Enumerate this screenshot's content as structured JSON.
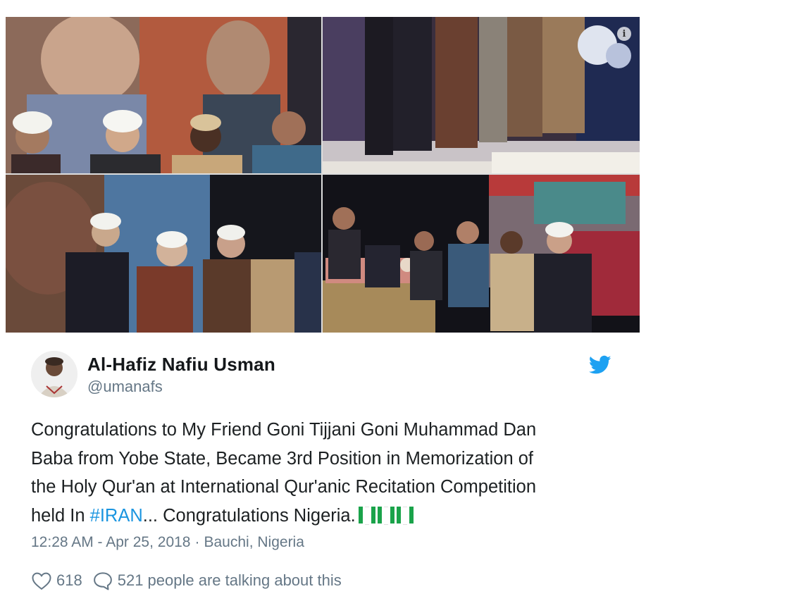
{
  "tweet": {
    "display_name": "Al-Hafiz Nafiu Usman",
    "handle": "@umanafs",
    "text_line1": "Congratulations to My Friend Goni Tijjani Goni Muhammad Dan",
    "text_line2": "Baba from Yobe State, Became 3rd Position in Memorization of",
    "text_line3": "the Holy Qur'an at International Qur'anic Recitation Competition",
    "text_line4_prefix": "held In ",
    "hashtag": "#IRAN",
    "text_line4_suffix": "... Congratulations Nigeria.",
    "timestamp": "12:28 AM - Apr 25, 2018",
    "separator": "·",
    "location": "Bauchi, Nigeria",
    "likes": "618",
    "talking": "521 people are talking about this"
  },
  "media": {
    "photo_count": 4,
    "info_icon_label": "i"
  },
  "icons": {
    "brand": "twitter-bird-icon",
    "like": "heart-icon",
    "reply": "speech-bubble-icon",
    "flag": "nigeria-flag-icon",
    "info": "info-icon"
  },
  "colors": {
    "name": "#14171a",
    "secondary": "#657786",
    "link": "#1b95e0",
    "twitter_blue": "#1da1f2",
    "flag_green": "#1aa34a"
  }
}
